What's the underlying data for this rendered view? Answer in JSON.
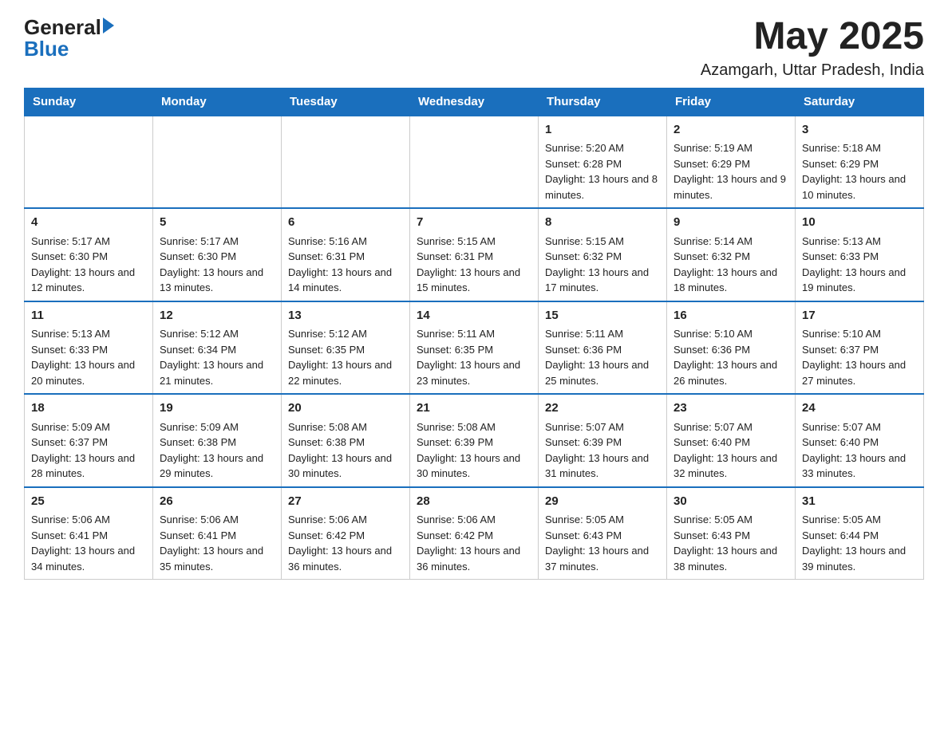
{
  "header": {
    "logo_text_general": "General",
    "logo_text_blue": "Blue",
    "month_year": "May 2025",
    "location": "Azamgarh, Uttar Pradesh, India"
  },
  "days_of_week": [
    "Sunday",
    "Monday",
    "Tuesday",
    "Wednesday",
    "Thursday",
    "Friday",
    "Saturday"
  ],
  "weeks": [
    [
      {
        "day": "",
        "sunrise": "",
        "sunset": "",
        "daylight": ""
      },
      {
        "day": "",
        "sunrise": "",
        "sunset": "",
        "daylight": ""
      },
      {
        "day": "",
        "sunrise": "",
        "sunset": "",
        "daylight": ""
      },
      {
        "day": "",
        "sunrise": "",
        "sunset": "",
        "daylight": ""
      },
      {
        "day": "1",
        "sunrise": "Sunrise: 5:20 AM",
        "sunset": "Sunset: 6:28 PM",
        "daylight": "Daylight: 13 hours and 8 minutes."
      },
      {
        "day": "2",
        "sunrise": "Sunrise: 5:19 AM",
        "sunset": "Sunset: 6:29 PM",
        "daylight": "Daylight: 13 hours and 9 minutes."
      },
      {
        "day": "3",
        "sunrise": "Sunrise: 5:18 AM",
        "sunset": "Sunset: 6:29 PM",
        "daylight": "Daylight: 13 hours and 10 minutes."
      }
    ],
    [
      {
        "day": "4",
        "sunrise": "Sunrise: 5:17 AM",
        "sunset": "Sunset: 6:30 PM",
        "daylight": "Daylight: 13 hours and 12 minutes."
      },
      {
        "day": "5",
        "sunrise": "Sunrise: 5:17 AM",
        "sunset": "Sunset: 6:30 PM",
        "daylight": "Daylight: 13 hours and 13 minutes."
      },
      {
        "day": "6",
        "sunrise": "Sunrise: 5:16 AM",
        "sunset": "Sunset: 6:31 PM",
        "daylight": "Daylight: 13 hours and 14 minutes."
      },
      {
        "day": "7",
        "sunrise": "Sunrise: 5:15 AM",
        "sunset": "Sunset: 6:31 PM",
        "daylight": "Daylight: 13 hours and 15 minutes."
      },
      {
        "day": "8",
        "sunrise": "Sunrise: 5:15 AM",
        "sunset": "Sunset: 6:32 PM",
        "daylight": "Daylight: 13 hours and 17 minutes."
      },
      {
        "day": "9",
        "sunrise": "Sunrise: 5:14 AM",
        "sunset": "Sunset: 6:32 PM",
        "daylight": "Daylight: 13 hours and 18 minutes."
      },
      {
        "day": "10",
        "sunrise": "Sunrise: 5:13 AM",
        "sunset": "Sunset: 6:33 PM",
        "daylight": "Daylight: 13 hours and 19 minutes."
      }
    ],
    [
      {
        "day": "11",
        "sunrise": "Sunrise: 5:13 AM",
        "sunset": "Sunset: 6:33 PM",
        "daylight": "Daylight: 13 hours and 20 minutes."
      },
      {
        "day": "12",
        "sunrise": "Sunrise: 5:12 AM",
        "sunset": "Sunset: 6:34 PM",
        "daylight": "Daylight: 13 hours and 21 minutes."
      },
      {
        "day": "13",
        "sunrise": "Sunrise: 5:12 AM",
        "sunset": "Sunset: 6:35 PM",
        "daylight": "Daylight: 13 hours and 22 minutes."
      },
      {
        "day": "14",
        "sunrise": "Sunrise: 5:11 AM",
        "sunset": "Sunset: 6:35 PM",
        "daylight": "Daylight: 13 hours and 23 minutes."
      },
      {
        "day": "15",
        "sunrise": "Sunrise: 5:11 AM",
        "sunset": "Sunset: 6:36 PM",
        "daylight": "Daylight: 13 hours and 25 minutes."
      },
      {
        "day": "16",
        "sunrise": "Sunrise: 5:10 AM",
        "sunset": "Sunset: 6:36 PM",
        "daylight": "Daylight: 13 hours and 26 minutes."
      },
      {
        "day": "17",
        "sunrise": "Sunrise: 5:10 AM",
        "sunset": "Sunset: 6:37 PM",
        "daylight": "Daylight: 13 hours and 27 minutes."
      }
    ],
    [
      {
        "day": "18",
        "sunrise": "Sunrise: 5:09 AM",
        "sunset": "Sunset: 6:37 PM",
        "daylight": "Daylight: 13 hours and 28 minutes."
      },
      {
        "day": "19",
        "sunrise": "Sunrise: 5:09 AM",
        "sunset": "Sunset: 6:38 PM",
        "daylight": "Daylight: 13 hours and 29 minutes."
      },
      {
        "day": "20",
        "sunrise": "Sunrise: 5:08 AM",
        "sunset": "Sunset: 6:38 PM",
        "daylight": "Daylight: 13 hours and 30 minutes."
      },
      {
        "day": "21",
        "sunrise": "Sunrise: 5:08 AM",
        "sunset": "Sunset: 6:39 PM",
        "daylight": "Daylight: 13 hours and 30 minutes."
      },
      {
        "day": "22",
        "sunrise": "Sunrise: 5:07 AM",
        "sunset": "Sunset: 6:39 PM",
        "daylight": "Daylight: 13 hours and 31 minutes."
      },
      {
        "day": "23",
        "sunrise": "Sunrise: 5:07 AM",
        "sunset": "Sunset: 6:40 PM",
        "daylight": "Daylight: 13 hours and 32 minutes."
      },
      {
        "day": "24",
        "sunrise": "Sunrise: 5:07 AM",
        "sunset": "Sunset: 6:40 PM",
        "daylight": "Daylight: 13 hours and 33 minutes."
      }
    ],
    [
      {
        "day": "25",
        "sunrise": "Sunrise: 5:06 AM",
        "sunset": "Sunset: 6:41 PM",
        "daylight": "Daylight: 13 hours and 34 minutes."
      },
      {
        "day": "26",
        "sunrise": "Sunrise: 5:06 AM",
        "sunset": "Sunset: 6:41 PM",
        "daylight": "Daylight: 13 hours and 35 minutes."
      },
      {
        "day": "27",
        "sunrise": "Sunrise: 5:06 AM",
        "sunset": "Sunset: 6:42 PM",
        "daylight": "Daylight: 13 hours and 36 minutes."
      },
      {
        "day": "28",
        "sunrise": "Sunrise: 5:06 AM",
        "sunset": "Sunset: 6:42 PM",
        "daylight": "Daylight: 13 hours and 36 minutes."
      },
      {
        "day": "29",
        "sunrise": "Sunrise: 5:05 AM",
        "sunset": "Sunset: 6:43 PM",
        "daylight": "Daylight: 13 hours and 37 minutes."
      },
      {
        "day": "30",
        "sunrise": "Sunrise: 5:05 AM",
        "sunset": "Sunset: 6:43 PM",
        "daylight": "Daylight: 13 hours and 38 minutes."
      },
      {
        "day": "31",
        "sunrise": "Sunrise: 5:05 AM",
        "sunset": "Sunset: 6:44 PM",
        "daylight": "Daylight: 13 hours and 39 minutes."
      }
    ]
  ]
}
